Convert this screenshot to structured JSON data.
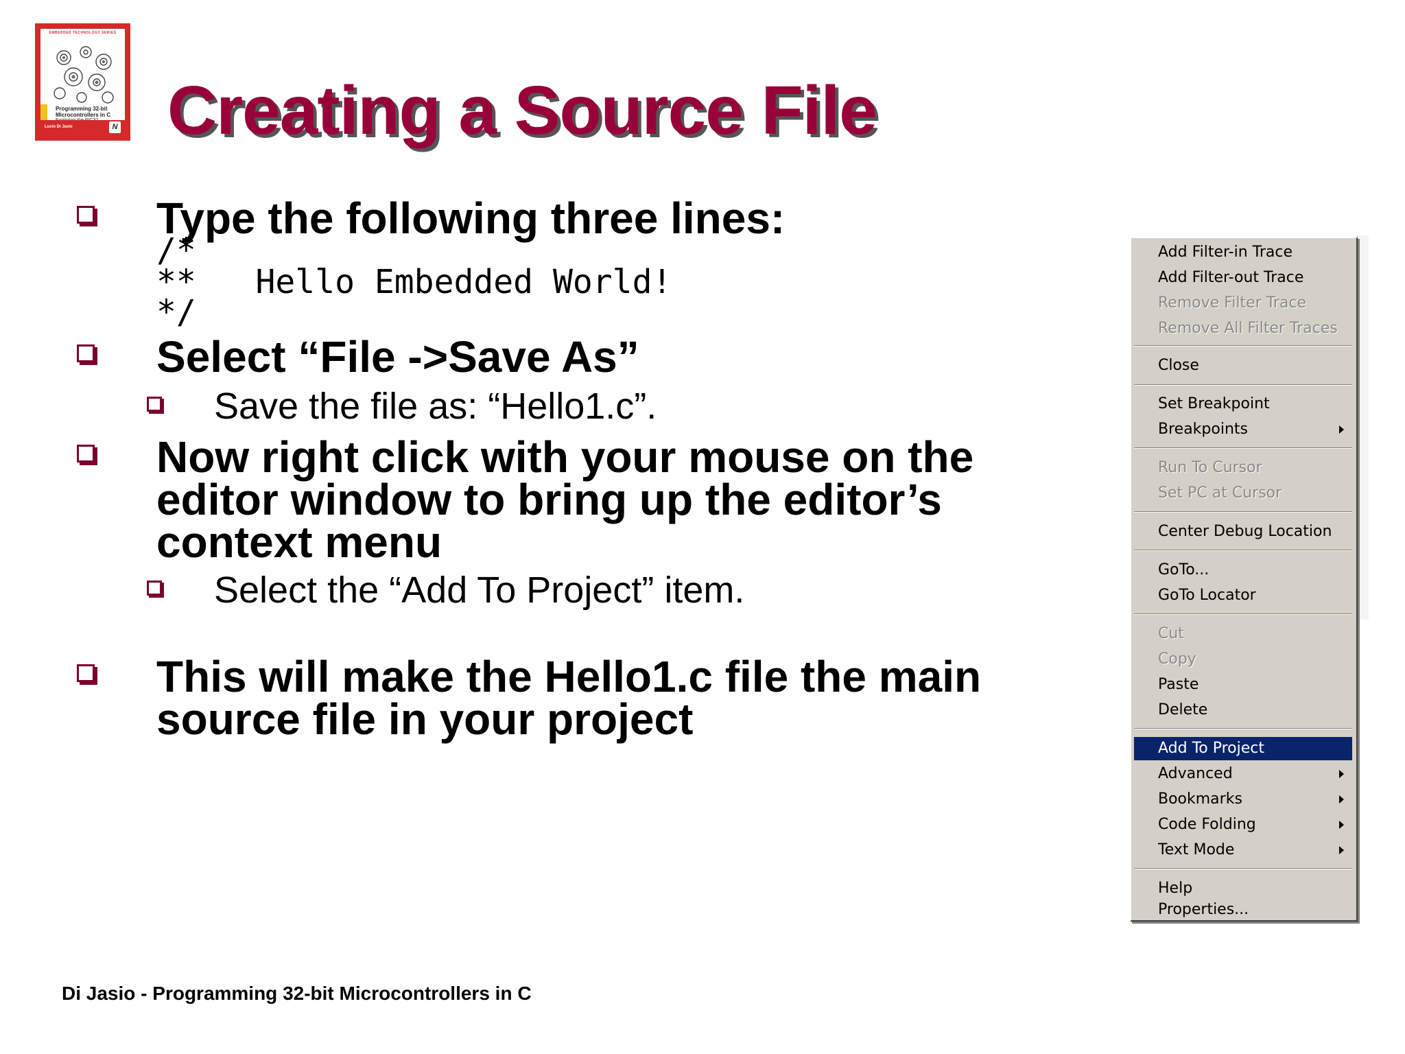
{
  "cover": {
    "series": "EMBEDDED TECHNOLOGY SERIES",
    "title": "Programming 32-bit Microcontrollers in C",
    "subtitle": "Exploring the PIC32",
    "author": "Lucio Di Jasio",
    "logo": "N",
    "brand_color": "#d42a2a"
  },
  "slide": {
    "title": "Creating a Source File",
    "title_color": "#99003a",
    "bullets": [
      "Type the following three lines:",
      "Select “File ->Save As”",
      "Now right click with your mouse on the",
      "editor window to bring up the editor’s",
      "context menu",
      "This will make the Hello1.c file the main",
      "source file in your project"
    ],
    "code_lines": [
      "/*",
      "**   Hello Embedded World!",
      "*/"
    ],
    "sub_bullets": [
      "Save the file as: “Hello1.c”.",
      "Select the “Add To Project” item."
    ],
    "footer": "Di Jasio - Programming 32-bit Microcontrollers in C"
  },
  "context_menu": {
    "selected_color": "#0a246a",
    "items": [
      {
        "label": "Add Filter-in Trace",
        "enabled": true
      },
      {
        "label": "Add Filter-out Trace",
        "enabled": true
      },
      {
        "label": "Remove Filter Trace",
        "enabled": false
      },
      {
        "label": "Remove All Filter Traces",
        "enabled": false
      },
      {
        "label": "Close",
        "enabled": true
      },
      {
        "label": "Set Breakpoint",
        "enabled": true
      },
      {
        "label": "Breakpoints",
        "enabled": true,
        "submenu": true
      },
      {
        "label": "Run To Cursor",
        "enabled": false
      },
      {
        "label": "Set PC at Cursor",
        "enabled": false
      },
      {
        "label": "Center Debug Location",
        "enabled": true
      },
      {
        "label": "GoTo...",
        "enabled": true
      },
      {
        "label": "GoTo Locator",
        "enabled": true
      },
      {
        "label": "Cut",
        "enabled": false
      },
      {
        "label": "Copy",
        "enabled": false
      },
      {
        "label": "Paste",
        "enabled": true
      },
      {
        "label": "Delete",
        "enabled": true
      },
      {
        "label": "Add To Project",
        "enabled": true,
        "selected": true
      },
      {
        "label": "Advanced",
        "enabled": true,
        "submenu": true
      },
      {
        "label": "Bookmarks",
        "enabled": true,
        "submenu": true
      },
      {
        "label": "Code Folding",
        "enabled": true,
        "submenu": true
      },
      {
        "label": "Text Mode",
        "enabled": true,
        "submenu": true
      },
      {
        "label": "Help",
        "enabled": true
      },
      {
        "label": "Properties...",
        "enabled": true
      }
    ]
  }
}
